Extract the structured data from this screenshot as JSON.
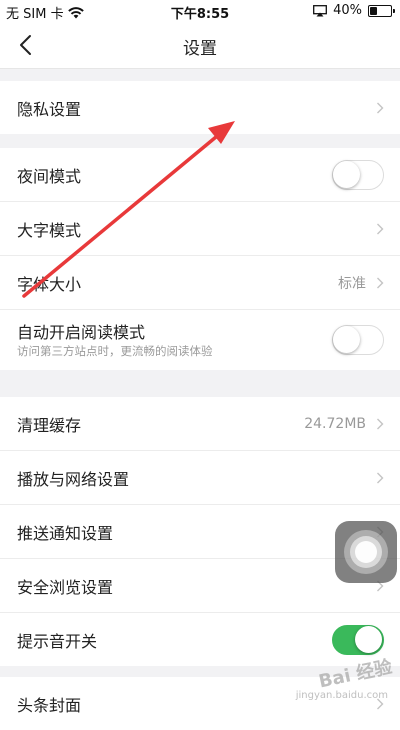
{
  "status_bar": {
    "carrier": "无 SIM 卡",
    "time": "下午8:55",
    "battery_percent": "40%",
    "battery_level": 0.4
  },
  "nav": {
    "title": "设置"
  },
  "groups": [
    {
      "items": [
        {
          "label": "隐私设置",
          "control": "chevron"
        }
      ]
    },
    {
      "items": [
        {
          "label": "夜间模式",
          "control": "toggle",
          "on": false
        },
        {
          "label": "大字模式",
          "control": "chevron"
        },
        {
          "label": "字体大小",
          "value": "标准",
          "control": "chevron"
        },
        {
          "label": "自动开启阅读模式",
          "sublabel": "访问第三方站点时，更流畅的阅读体验",
          "control": "toggle",
          "on": false
        }
      ]
    },
    {
      "items": [
        {
          "label": "清理缓存",
          "value": "24.72MB",
          "control": "chevron"
        },
        {
          "label": "播放与网络设置",
          "control": "chevron"
        },
        {
          "label": "推送通知设置",
          "control": "chevron"
        },
        {
          "label": "安全浏览设置",
          "control": "chevron"
        },
        {
          "label": "提示音开关",
          "control": "toggle",
          "on": true
        }
      ]
    },
    {
      "items": [
        {
          "label": "头条封面",
          "control": "chevron"
        }
      ]
    }
  ],
  "colors": {
    "toggle_on": "#3ab95b",
    "annotation_arrow": "#e8393a"
  },
  "watermark": {
    "text": "Bai 经验",
    "sub": "jingyan.baidu.com"
  }
}
